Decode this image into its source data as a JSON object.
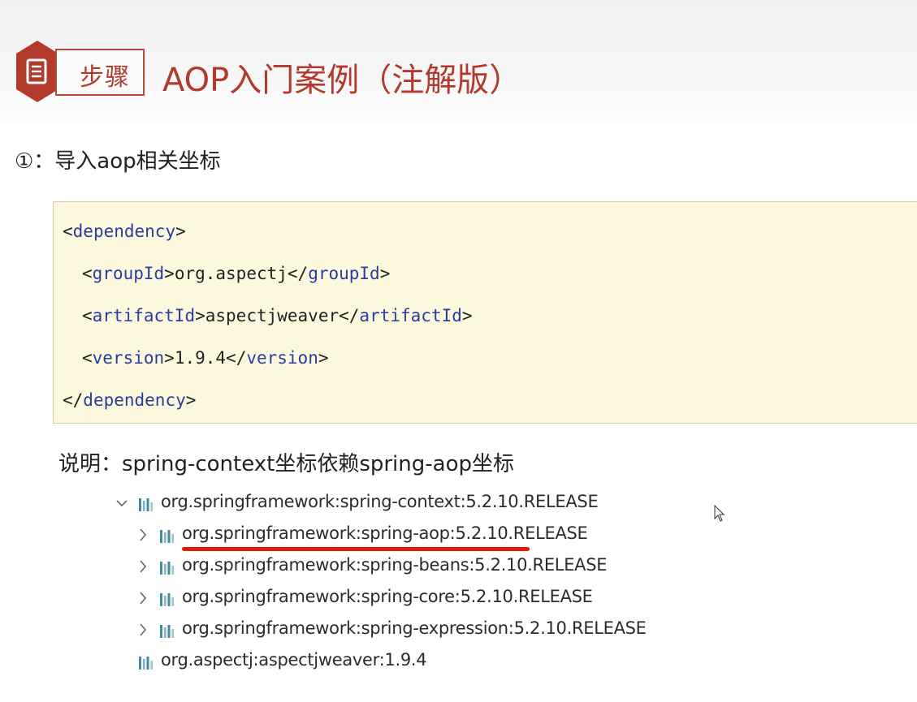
{
  "header": {
    "badge_label": "步骤",
    "title": "AOP入门案例（注解版）"
  },
  "step": {
    "heading": "①：导入aop相关坐标"
  },
  "code": {
    "lines": [
      {
        "open": "<",
        "tag": "dependency",
        "close": ">",
        "text": "",
        "tag2": "",
        "close2": ""
      },
      {
        "open": "<",
        "tag": "groupId",
        "close": ">",
        "text": "org.aspectj",
        "endopen": "</",
        "tag2": "groupId",
        "close2": ">"
      },
      {
        "open": "<",
        "tag": "artifactId",
        "close": ">",
        "text": "aspectjweaver",
        "endopen": "</",
        "tag2": "artifactId",
        "close2": ">"
      },
      {
        "open": "<",
        "tag": "version",
        "close": ">",
        "text": "1.9.4",
        "endopen": "</",
        "tag2": "version",
        "close2": ">"
      },
      {
        "open": "</",
        "tag": "dependency",
        "close": ">",
        "text": "",
        "tag2": "",
        "close2": ""
      }
    ]
  },
  "note": {
    "text": "说明：spring-context坐标依赖spring-aop坐标"
  },
  "tree": {
    "items": [
      {
        "label": "org.springframework:spring-context:5.2.10.RELEASE",
        "chevron": "chevron-down-icon"
      },
      {
        "label": "org.springframework:spring-aop:5.2.10.RELEASE",
        "chevron": "chevron-right-icon"
      },
      {
        "label": "org.springframework:spring-beans:5.2.10.RELEASE",
        "chevron": "chevron-right-icon"
      },
      {
        "label": "org.springframework:spring-core:5.2.10.RELEASE",
        "chevron": "chevron-right-icon"
      },
      {
        "label": "org.springframework:spring-expression:5.2.10.RELEASE",
        "chevron": "chevron-right-icon"
      },
      {
        "label": "org.aspectj:aspectjweaver:1.9.4",
        "chevron": ""
      }
    ]
  },
  "colors": {
    "accent": "#b23a2c",
    "tag": "#2a3d9c",
    "code_bg": "#fbf8de",
    "highlight_underline": "#e01a0a",
    "library_icon": "#3e8e9e"
  }
}
